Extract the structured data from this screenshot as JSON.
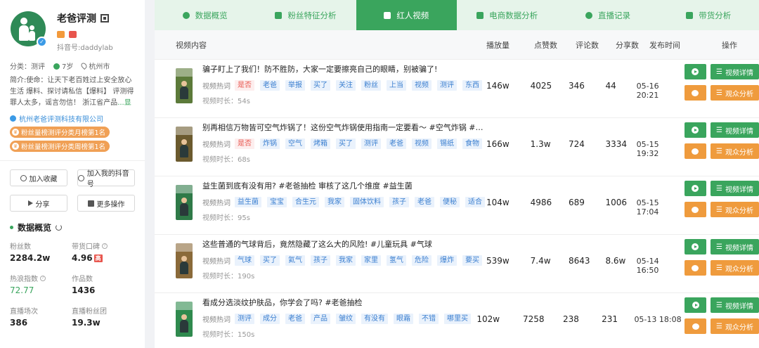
{
  "profile": {
    "name": "老爸评测",
    "douyin_id": "抖音号:daddylab",
    "category": "分类：测评",
    "age": "7岁",
    "city": "杭州市",
    "bio": "简介:使命：让天下老百姓过上安全放心生活 爆料、探讨请私信【爆料】 评测得罪人太多，谣言勿信！ 浙江省产品",
    "bio_more": "...显示",
    "company": "杭州老爸评测科技有限公司",
    "ranks": [
      "粉丝量榜测评分类月榜第1名",
      "粉丝量榜测评分类周榜第1名"
    ]
  },
  "actions": {
    "favorite": "加入收藏",
    "add_douyin": "加入我的抖音号",
    "share": "分享",
    "more": "更多操作"
  },
  "overview": {
    "title": "数据概览",
    "stats": [
      {
        "label": "粉丝数",
        "value": "2284.2w"
      },
      {
        "label": "带货口碑",
        "value": "4.96",
        "badge": "高"
      },
      {
        "label": "热浪指数",
        "value": "72.77"
      },
      {
        "label": "作品数",
        "value": "1436"
      },
      {
        "label": "直播场次",
        "value": "386"
      },
      {
        "label": "直播粉丝团",
        "value": "19.3w"
      }
    ]
  },
  "tabs": [
    "数据概览",
    "粉丝特征分析",
    "红人视频",
    "电商数据分析",
    "直播记录",
    "带货分析"
  ],
  "active_tab": "红人视频",
  "table": {
    "headers": {
      "content": "视频内容",
      "plays": "播放量",
      "likes": "点赞数",
      "comments": "评论数",
      "shares": "分享数",
      "time": "发布时间",
      "ops": "操作"
    },
    "hot_words_label": "视频热词",
    "duration_label": "视频时长：",
    "detail_btn": "视频详情",
    "audience_btn": "观众分析",
    "rows": [
      {
        "title": "骗子盯上了我们！防不胜防，大家一定要擦亮自己的眼睛，别被骗了!",
        "tags": [
          "是否",
          "老爸",
          "举报",
          "买了",
          "关注",
          "粉丝",
          "上当",
          "视频",
          "测评",
          "东西"
        ],
        "duration": "54s",
        "plays": "146w",
        "likes": "4025",
        "comments": "346",
        "shares": "44",
        "time": "05-16 20:21",
        "thumb_color": "#5c7a3a"
      },
      {
        "title": "别再相信万物皆可空气炸锅了！这份空气炸锅使用指南一定要看～ #空气炸锅 #食谱 #...",
        "tags": [
          "是否",
          "炸锅",
          "空气",
          "烤箱",
          "买了",
          "测评",
          "老爸",
          "视频",
          "锡纸",
          "食物"
        ],
        "duration": "68s",
        "plays": "166w",
        "likes": "1.3w",
        "comments": "724",
        "shares": "3334",
        "time": "05-15 19:32",
        "thumb_color": "#6b5a2e"
      },
      {
        "title": "益生菌到底有没有用? #老爸抽检 审核了这几个维度 #益生菌",
        "tags": [
          "益生菌",
          "宝宝",
          "合生元",
          "我家",
          "固体饮料",
          "孩子",
          "老爸",
          "便秘",
          "适合"
        ],
        "duration": "95s",
        "plays": "104w",
        "likes": "4986",
        "comments": "689",
        "shares": "1006",
        "time": "05-15 17:04",
        "thumb_color": "#2f7a48"
      },
      {
        "title": "这些普通的气球背后，竟然隐藏了这么大的风险! #儿童玩具 #气球",
        "tags": [
          "气球",
          "买了",
          "氦气",
          "孩子",
          "我家",
          "家里",
          "氢气",
          "危险",
          "爆炸",
          "要买"
        ],
        "duration": "190s",
        "plays": "539w",
        "likes": "7.4w",
        "comments": "8643",
        "shares": "8.6w",
        "time": "05-14 16:50",
        "thumb_color": "#8a6a3a"
      },
      {
        "title": "看成分选淡纹护肤品，你学会了吗? #老爸抽检",
        "tags": [
          "测评",
          "成分",
          "老爸",
          "产品",
          "皱纹",
          "有没有",
          "眼霜",
          "不错",
          "哪里买"
        ],
        "duration": "150s",
        "plays": "102w",
        "likes": "7258",
        "comments": "238",
        "shares": "231",
        "time": "05-13 18:08",
        "thumb_color": "#2f8a4e"
      }
    ]
  },
  "colors": {
    "accent": "#3aa55d",
    "orange": "#ef9b3d",
    "tag_blue": "#3b7fd0",
    "tag_red": "#e8554d"
  }
}
